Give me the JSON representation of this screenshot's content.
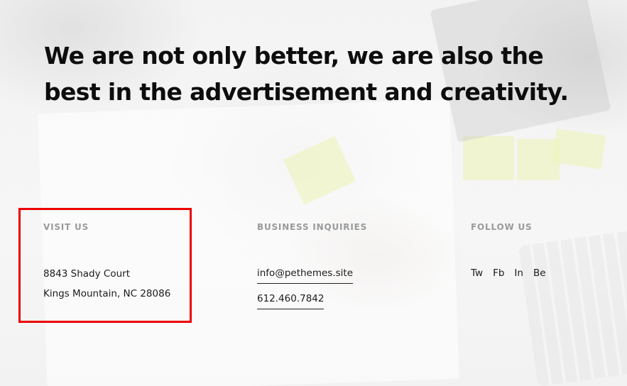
{
  "headline": "We are not only better, we are also the best in the advertisement and creativity.",
  "visit": {
    "title": "VISIT US",
    "address_line_1": "8843 Shady Court",
    "address_line_2": "Kings Mountain, NC 28086"
  },
  "business": {
    "title": "BUSINESS INQUIRIES",
    "email": "info@pethemes.site",
    "phone": "612.460.7842"
  },
  "follow": {
    "title": "FOLLOW US",
    "links": [
      "Tw",
      "Fb",
      "In",
      "Be"
    ]
  },
  "highlight_color": "#ec0000"
}
